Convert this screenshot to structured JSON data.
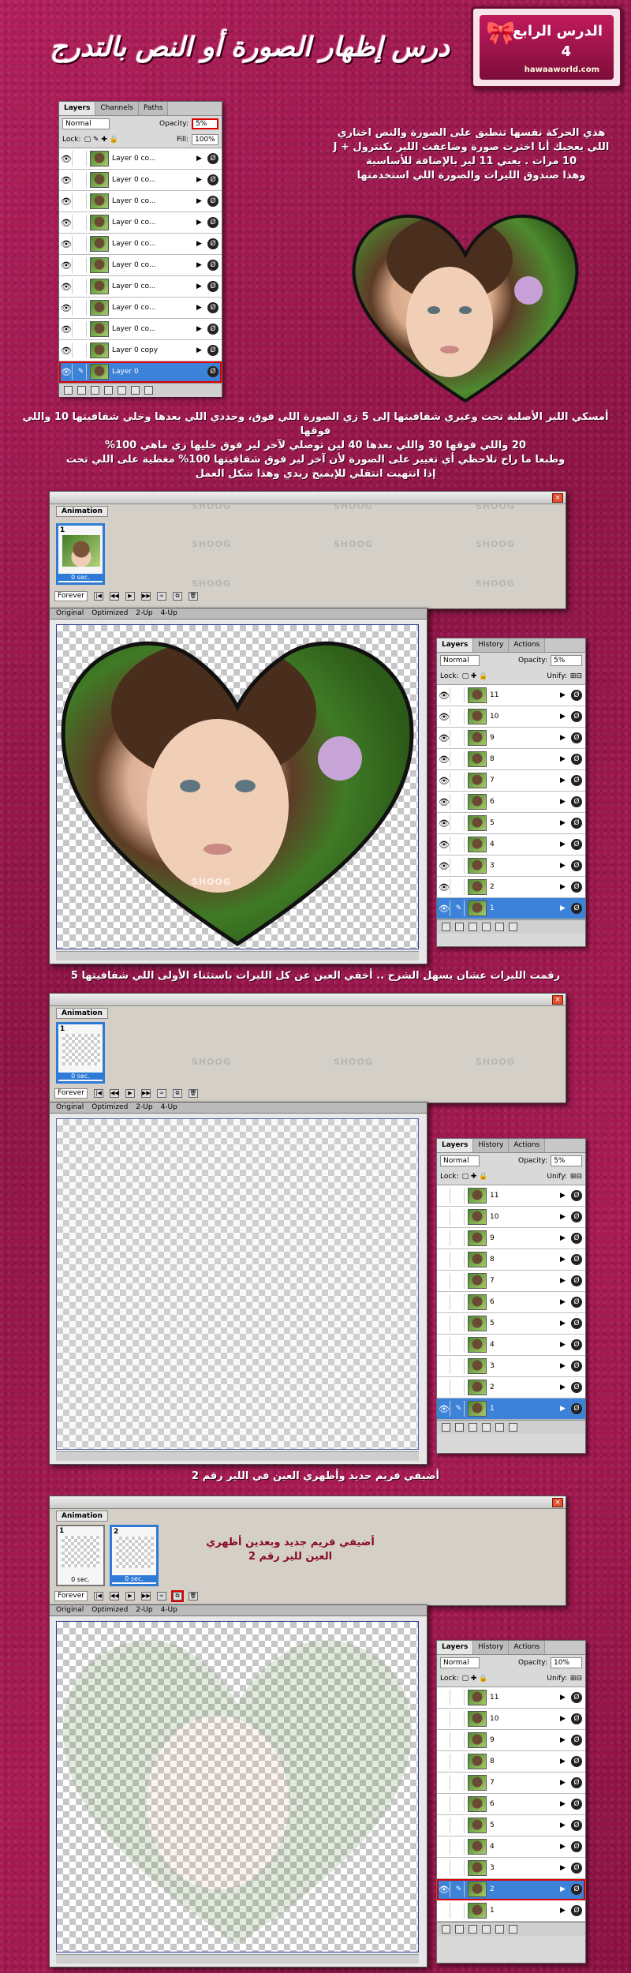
{
  "header": {
    "badge_line1": "الدرس الرابع",
    "badge_line2": "4",
    "badge_site": "hawaaworld.com",
    "title": "درس إظهار الصورة أو النص بالتدرج"
  },
  "layers_panel_1": {
    "tabs": [
      "Layers",
      "Channels",
      "Paths"
    ],
    "blend": "Normal",
    "opacity_label": "Opacity:",
    "opacity": "5%",
    "lock_label": "Lock:",
    "fill_label": "Fill:",
    "fill": "100%",
    "layers": [
      "Layer 0 co...",
      "Layer 0 co...",
      "Layer 0 co...",
      "Layer 0 co...",
      "Layer 0 co...",
      "Layer 0 co...",
      "Layer 0 co...",
      "Layer 0 co...",
      "Layer 0 co...",
      "Layer 0 copy",
      "Layer 0"
    ]
  },
  "text1": {
    "line1": "هذي الحركة نفسها تنطبق على الصورة والنص اختاري",
    "line2": "اللي يعجبك أنا اخترت صورة وضاعفت اللير بكنترول + J",
    "line3": "10 مرات . يعني 11 لير بالإضافة للأساسية",
    "line4": "وهذا صندوق الليرات والصورة اللي استخدمتها"
  },
  "text2": {
    "line1": "أمسكي اللير الأصلية تحت وغيري شفافيتها إلى 5 زي الصورة اللي فوق، وحددي اللي بعدها وخلي شفافيتها 10 واللي فوقها",
    "line2": "20 واللي فوقها 30 واللي بعدها 40 لين توصلي لآخر لير فوق خليها زي ماهي 100%",
    "line3": "وطبعا ما راح تلاحظي أي تغيير على الصورة لأن آخر لير فوق شفافيتها 100% مغطية على اللي تحت",
    "line4": "إذا انتهيت انتقلي للإيميج ريدي وهذا شكل العمل"
  },
  "animation": {
    "title": "Animation",
    "forever": "Forever",
    "frame_duration": "0 sec.",
    "frame1": "1",
    "frame2": "2",
    "watermark": "SHOOG"
  },
  "canvas": {
    "tabs": [
      "Original",
      "Optimized",
      "2-Up",
      "4-Up"
    ]
  },
  "layers_panel_2": {
    "tabs": [
      "Layers",
      "History",
      "Actions"
    ],
    "blend": "Normal",
    "opacity_label": "Opacity:",
    "unify_label": "Unify:",
    "lock_label": "Lock:",
    "opacity_a": "5%",
    "opacity_b": "5%",
    "opacity_c": "10%",
    "layers": [
      "11",
      "10",
      "9",
      "8",
      "7",
      "6",
      "5",
      "4",
      "3",
      "2",
      "1"
    ]
  },
  "caption1": "رقمت الليرات عشان يسهل الشرح .. أخفي العين عن كل الليرات باستثناء الأولى اللي شفافيتها 5",
  "caption2": "أضيفي فريم جديد وأظهري العين في اللير رقم 2",
  "caption3": "أضيفي فريم جديد وبعدين أظهري العين للير رقم 2",
  "colors": {
    "background": "#a0194f",
    "selection": "#3c82d8",
    "highlight": "#dd0000"
  }
}
